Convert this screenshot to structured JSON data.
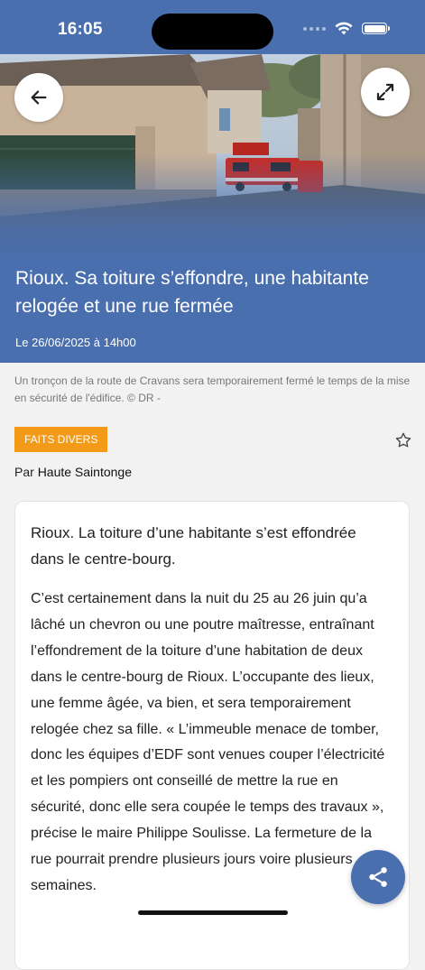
{
  "status_bar": {
    "time": "16:05"
  },
  "article": {
    "title": "Rioux. Sa toiture s’effondre, une habitante relogée et une rue fermée",
    "date": "Le 26/06/2025 à 14h00",
    "photo_caption": "Un tronçon de la route de Cravans sera temporairement fermé le temps de la mise en sécurité de l'édifice. © DR -",
    "category": "FAITS DIVERS",
    "author_prefix": "Par",
    "author": "Haute Saintonge",
    "lead": "Rioux. La toiture d’une habitante s’est effondrée dans le centre-bourg.",
    "body": "C’est certainement dans la nuit du 25 au 26 juin qu’a lâché un chevron ou une poutre maîtresse, entraînant l’effondrement de la toiture d’une habitation de deux dans le centre-bourg de Rioux. L’occupante des lieux, une femme âgée, va bien, et sera temporairement relogée chez sa fille. « L’immeuble menace de tomber, donc les équipes d’EDF sont venues couper l’électricité et les pompiers ont conseillé de mettre la rue en sécurité, donc elle sera coupée le temps des travaux », précise le maire Philippe Soulisse. La fermeture de la rue pourrait prendre plusieurs jours voire plusieurs semaines."
  },
  "icons": {
    "back": "arrow-left-icon",
    "expand": "expand-diagonal-icon",
    "bookmark": "star-outline-icon",
    "share": "share-icon"
  },
  "colors": {
    "brand_blue": "#4a6fae",
    "category_orange": "#f39a18",
    "background": "#f2f2f2"
  }
}
